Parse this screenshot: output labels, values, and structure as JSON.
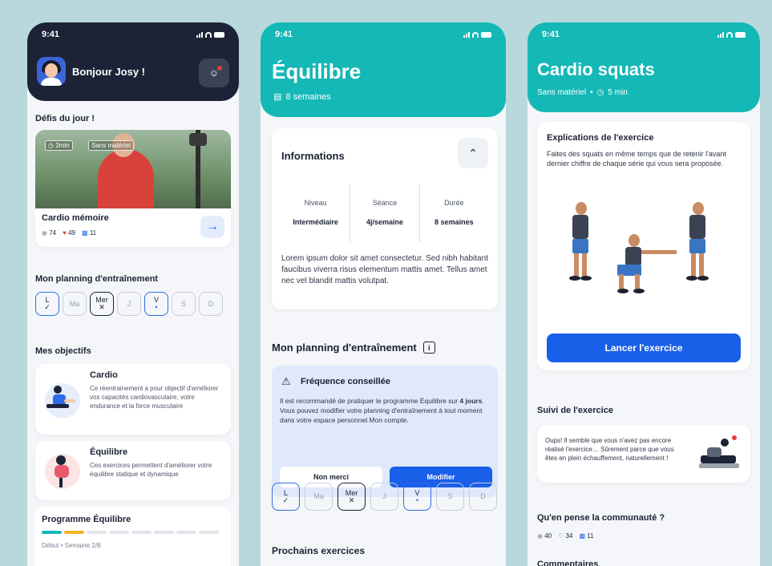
{
  "status": {
    "time": "9:41"
  },
  "home": {
    "greeting": "Bonjour Josy !",
    "defis_title": "Défis du jour !",
    "hero": {
      "tag_duration": "2min",
      "tag_equipment": "Sans matériel",
      "title": "Cardio mémoire",
      "views": "74",
      "likes": "49",
      "comments": "11",
      "arrow": "→"
    },
    "planning_title": "Mon planning d'entraînement",
    "days": [
      {
        "label": "L",
        "state": "done"
      },
      {
        "label": "Ma",
        "state": "off"
      },
      {
        "label": "Mer",
        "state": "missed"
      },
      {
        "label": "J",
        "state": "off"
      },
      {
        "label": "V",
        "state": "current"
      },
      {
        "label": "S",
        "state": "off"
      },
      {
        "label": "D",
        "state": "off"
      }
    ],
    "objectifs_title": "Mes objectifs",
    "objectives": [
      {
        "title": "Cardio",
        "desc": "Ce réentrainement a pour objectif d'améliorer vos capacités cardiovasculaire, votre endurance et la force musculaire"
      },
      {
        "title": "Équilibre",
        "desc": "Ces exercices permettent d'améliorer votre équilibre statique et dynamique"
      }
    ],
    "program": {
      "title": "Programme Équilibre",
      "start": "Début",
      "week": "Semaine 2/8",
      "progress_segments_done": 2,
      "progress_segments_total": 8
    }
  },
  "program": {
    "title": "Équilibre",
    "duration": "8 semaines",
    "info_title": "Informations",
    "info_cols": [
      {
        "label": "Niveau",
        "value": "Intermédiaire"
      },
      {
        "label": "Séance",
        "value": "4j/semaine"
      },
      {
        "label": "Durée",
        "value": "8 semaines"
      }
    ],
    "info_text": "Lorem ipsum dolor sit amet consectetur. Sed nibh habitant faucibus viverra risus elementum mattis amet. Tellus amet nec vel blandit mattis volutpat.",
    "planning_title": "Mon planning d'entraînement",
    "freq_title": "Fréquence conseillée",
    "freq_text_1": "Il est recommandé de pratiquer le programme Équilibre sur ",
    "freq_text_bold": "4 jours",
    "freq_text_2": ". Vous pouvez modifier votre planning d'entraînement à tout moment dans votre espace personnel Mon compte.",
    "btn_no": "Non merci",
    "btn_modify": "Modifier",
    "next_title": "Prochains exercices"
  },
  "exercise": {
    "title": "Cardio squats",
    "equipment": "Sans matériel",
    "duration": "5 min",
    "explain_title": "Explications de l'exercice",
    "explain_text": "Faites des squats en même temps que de retenir l'avant dernier chiffre de chaque série qui vous sera proposée.",
    "launch": "Lancer l'exercice",
    "suivi_title": "Suivi de l'exercice",
    "suivi_text": "Oups! Il semble que vous n'avez pas encore réalisé l'exercice… Sûrement parce que vous êtes en plein échauffement, naturellement !",
    "community_title": "Qu'en pense la communauté ?",
    "views": "40",
    "likes": "34",
    "comments": "11",
    "comments_title": "Commentaires"
  },
  "colors": {
    "teal": "#14b8b6",
    "navy": "#1c2336",
    "blue": "#1a5fe8",
    "bg": "#b8d8dc"
  }
}
